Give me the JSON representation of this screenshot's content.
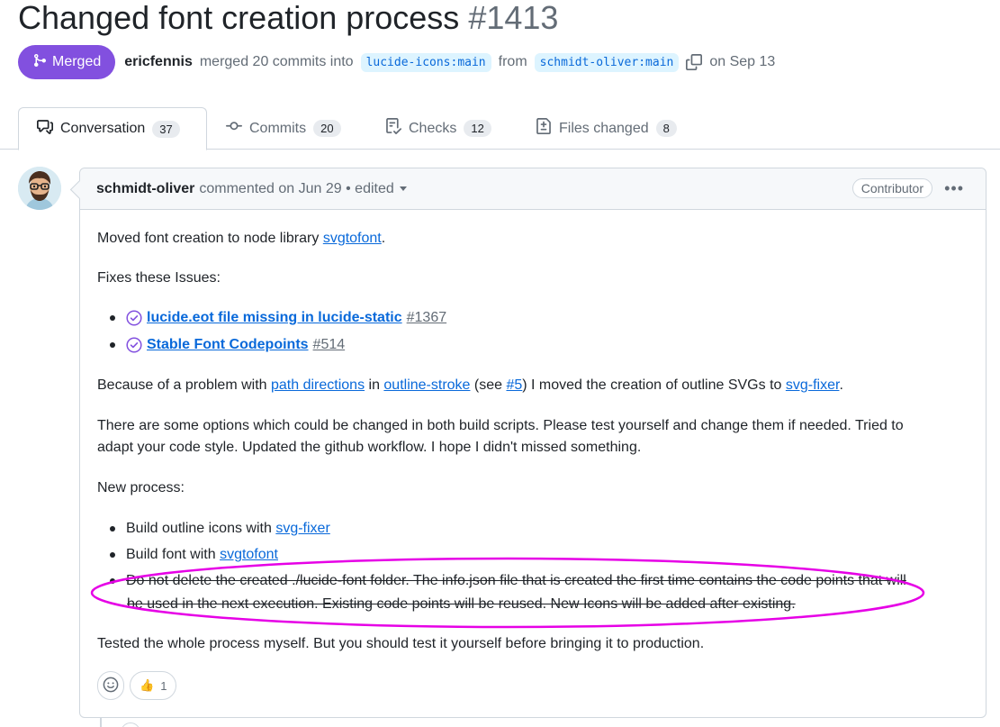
{
  "pr": {
    "title": "Changed font creation process",
    "number": "#1413",
    "status": "Merged",
    "merger": "ericfennis",
    "merge_text": "merged 20 commits into",
    "base_branch": "lucide-icons:main",
    "from_text": "from",
    "head_branch": "schmidt-oliver:main",
    "date_text": "on Sep 13"
  },
  "tabs": [
    {
      "label": "Conversation",
      "count": "37",
      "icon": "conversation-icon"
    },
    {
      "label": "Commits",
      "count": "20",
      "icon": "commit-icon"
    },
    {
      "label": "Checks",
      "count": "12",
      "icon": "checklist-icon"
    },
    {
      "label": "Files changed",
      "count": "8",
      "icon": "file-diff-icon"
    }
  ],
  "comment": {
    "author": "schmidt-oliver",
    "meta": "commented on Jun 29 • edited",
    "role": "Contributor",
    "intro": "Moved font creation to node library ",
    "intro_link": "svgtofont",
    "intro_end": ".",
    "fixes_heading": "Fixes these Issues:",
    "issues": [
      {
        "title": "lucide.eot file missing in lucide-static",
        "number": "#1367"
      },
      {
        "title": "Stable Font Codepoints",
        "number": "#514"
      }
    ],
    "p2_a": "Because of a problem with ",
    "p2_link1": "path directions",
    "p2_b": " in ",
    "p2_link2": "outline-stroke",
    "p2_c": " (see ",
    "p2_link3": "#5",
    "p2_d": ") I moved the creation of outline SVGs to ",
    "p2_link4": "svg-fixer",
    "p2_e": ".",
    "p3_line1": "There are some options which could be changed in both build scripts. Please test yourself and change them if needed. Tried to",
    "p3_line2": "adapt your code style. Updated the github workflow. I hope I didn't missed something.",
    "process_heading": "New process:",
    "step1_text": "Build outline icons with ",
    "step1_link": "svg-fixer",
    "step2_text": "Build font with ",
    "step2_link": "svgtofont",
    "step3_line1": "Do not delete the created ./lucide-font folder. The info.json file that is created the first time contains the code points that will",
    "step3_line2": "be used in the next execution. Existing code points will be reused. New Icons will be added after existing.",
    "closing": "Tested the whole process myself. But you should test it yourself before bringing it to production.",
    "reactions": [
      {
        "emoji": "👍",
        "count": "1"
      }
    ]
  },
  "colors": {
    "merged": "#8250df",
    "link": "#0969da",
    "annotation": "#e600e6",
    "border": "#d0d7de"
  }
}
